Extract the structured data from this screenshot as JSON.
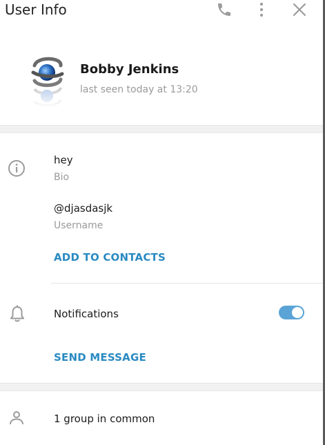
{
  "header": {
    "title": "User Info",
    "icons": [
      "phone-icon",
      "more-vertical-icon",
      "close-icon"
    ]
  },
  "profile": {
    "name": "Bobby Jenkins",
    "status": "last seen today at 13:20",
    "avatar_icon": "swirl-logo-avatar"
  },
  "info": {
    "bio_value": "hey",
    "bio_label": "Bio",
    "username_value": "@djasdasjk",
    "username_label": "Username",
    "add_contacts": "ADD TO CONTACTS"
  },
  "notifications": {
    "label": "Notifications",
    "enabled": true,
    "send_message": "SEND MESSAGE"
  },
  "groups": {
    "label": "1 group in common"
  },
  "colors": {
    "accent": "#2a8ac2",
    "toggle_on": "#5aa3d6",
    "muted_text": "#9a9a9a",
    "icon_gray": "#9b9b9b"
  }
}
